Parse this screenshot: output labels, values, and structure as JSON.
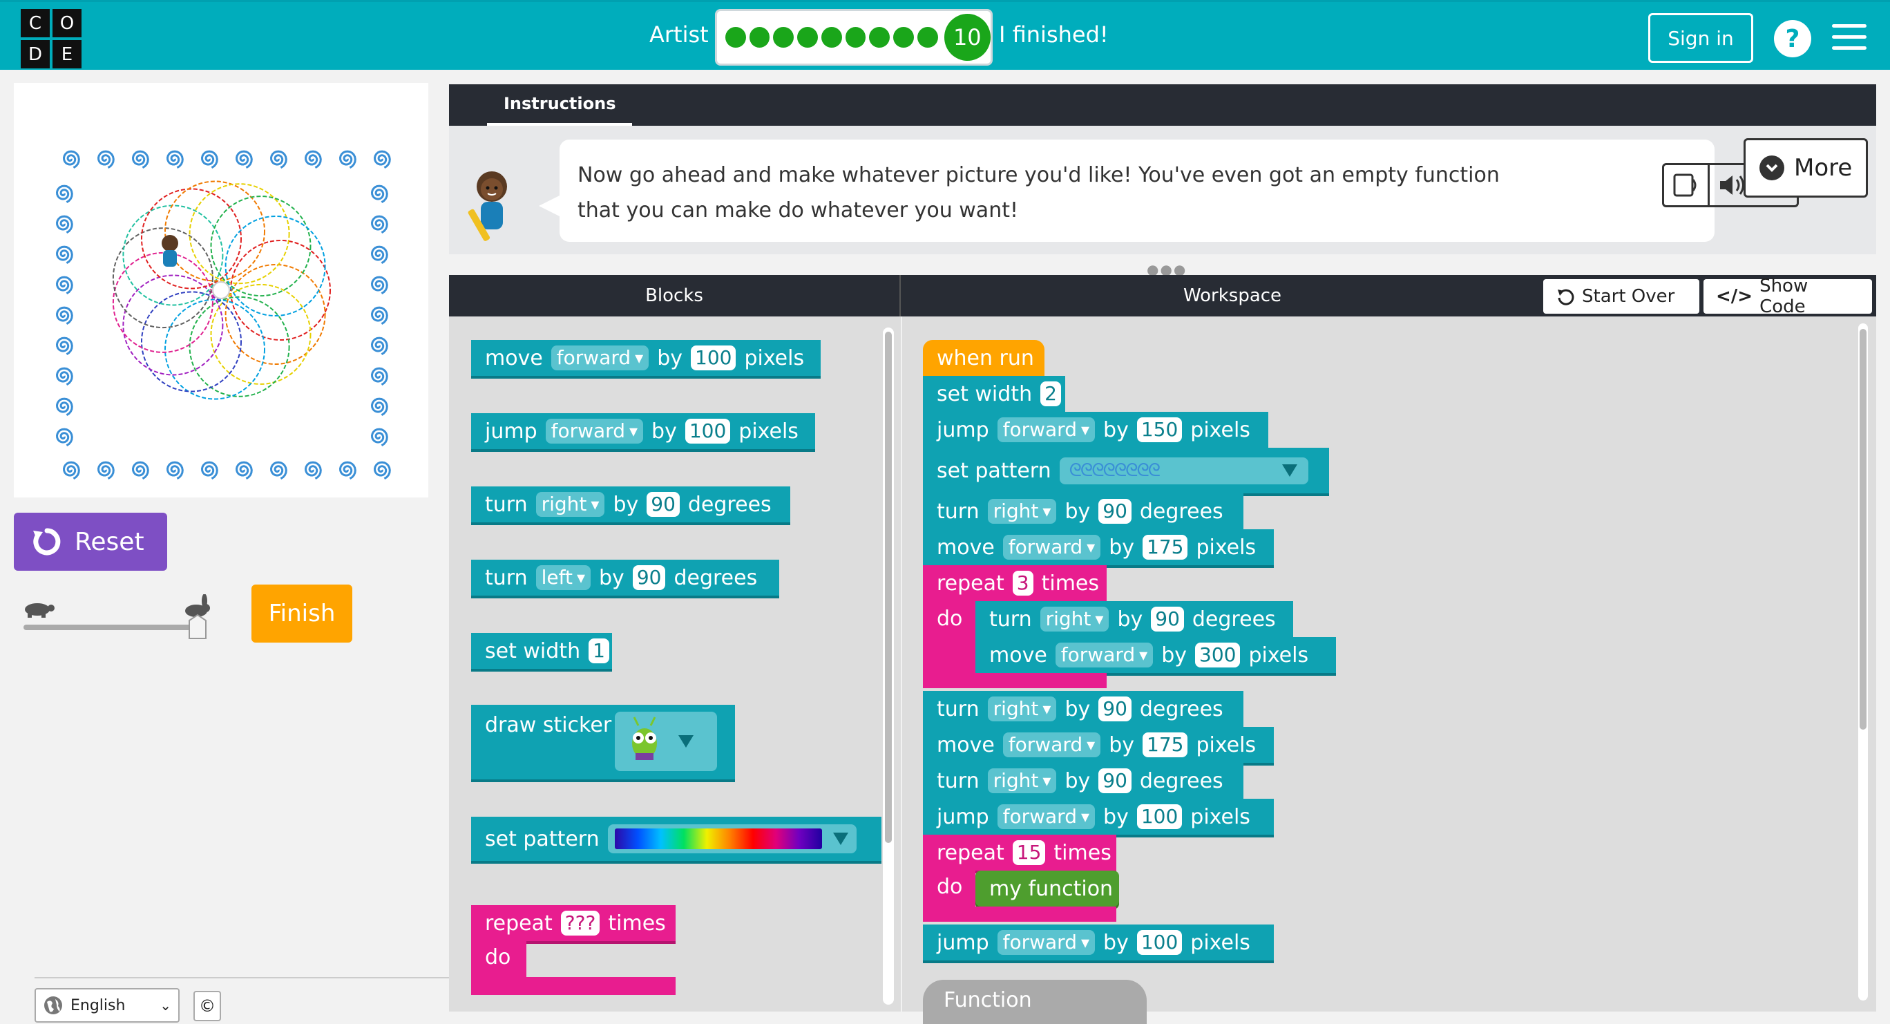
{
  "header": {
    "logo_letters": [
      "C",
      "O",
      "D",
      "E"
    ],
    "level_name": "Artist",
    "progress_dots": 9,
    "current_level": "10",
    "finished_label": "I finished!",
    "signin_label": "Sign in",
    "help_label": "?"
  },
  "left_pane": {
    "reset_label": "Reset",
    "finish_label": "Finish",
    "language": "English",
    "copyright_symbol": "©",
    "speed_slider_value": 1.0
  },
  "instructions": {
    "tab_label": "Instructions",
    "text_line1": "Now go ahead and make whatever picture you'd like! You've even got an empty function",
    "text_line2": "that you can make do whatever you want!",
    "more_label": "More"
  },
  "code_area": {
    "blocks_header": "Blocks",
    "workspace_header": "Workspace",
    "start_over_label": "Start Over",
    "show_code_label": "Show Code",
    "show_code_icon": "</>"
  },
  "toolbox": {
    "move": {
      "word": "move",
      "dir": "forward",
      "by": "by",
      "value": "100",
      "unit": "pixels"
    },
    "jump": {
      "word": "jump",
      "dir": "forward",
      "by": "by",
      "value": "100",
      "unit": "pixels"
    },
    "turn_right": {
      "word": "turn",
      "dir": "right",
      "by": "by",
      "value": "90",
      "unit": "degrees"
    },
    "turn_left": {
      "word": "turn",
      "dir": "left",
      "by": "by",
      "value": "90",
      "unit": "degrees"
    },
    "set_width": {
      "word": "set width",
      "value": "1"
    },
    "draw_sticker": {
      "word": "draw sticker"
    },
    "set_pattern": {
      "word": "set pattern"
    },
    "repeat": {
      "word": "repeat",
      "value": "???",
      "times": "times",
      "do": "do"
    }
  },
  "workspace": {
    "when_run": "when run",
    "set_width": {
      "word": "set width",
      "value": "2"
    },
    "jump1": {
      "word": "jump",
      "dir": "forward",
      "by": "by",
      "value": "150",
      "unit": "pixels"
    },
    "set_pattern": {
      "word": "set pattern",
      "swirl": "ᘓᘓᘓᘓᘓᘓᘓᘓ"
    },
    "turn1": {
      "word": "turn",
      "dir": "right",
      "by": "by",
      "value": "90",
      "unit": "degrees"
    },
    "move1": {
      "word": "move",
      "dir": "forward",
      "by": "by",
      "value": "175",
      "unit": "pixels"
    },
    "repeat1": {
      "word": "repeat",
      "value": "3",
      "times": "times",
      "do": "do"
    },
    "inner_turn": {
      "word": "turn",
      "dir": "right",
      "by": "by",
      "value": "90",
      "unit": "degrees"
    },
    "inner_move": {
      "word": "move",
      "dir": "forward",
      "by": "by",
      "value": "300",
      "unit": "pixels"
    },
    "turn2": {
      "word": "turn",
      "dir": "right",
      "by": "by",
      "value": "90",
      "unit": "degrees"
    },
    "move2": {
      "word": "move",
      "dir": "forward",
      "by": "by",
      "value": "175",
      "unit": "pixels"
    },
    "turn3": {
      "word": "turn",
      "dir": "right",
      "by": "by",
      "value": "90",
      "unit": "degrees"
    },
    "jump2": {
      "word": "jump",
      "dir": "forward",
      "by": "by",
      "value": "100",
      "unit": "pixels"
    },
    "repeat2": {
      "word": "repeat",
      "value": "15",
      "times": "times",
      "do": "do"
    },
    "my_function": "my function",
    "jump3": {
      "word": "jump",
      "dir": "forward",
      "by": "by",
      "value": "100",
      "unit": "pixels"
    },
    "function_category": "Function"
  },
  "colors": {
    "header": "#00adbc",
    "reset": "#7e4fc4",
    "finish": "#ffa400",
    "block_teal": "#0fa2b2",
    "loop_pink": "#e81d8f",
    "event_orange": "#ffa400",
    "function_green": "#4e9e2e"
  }
}
